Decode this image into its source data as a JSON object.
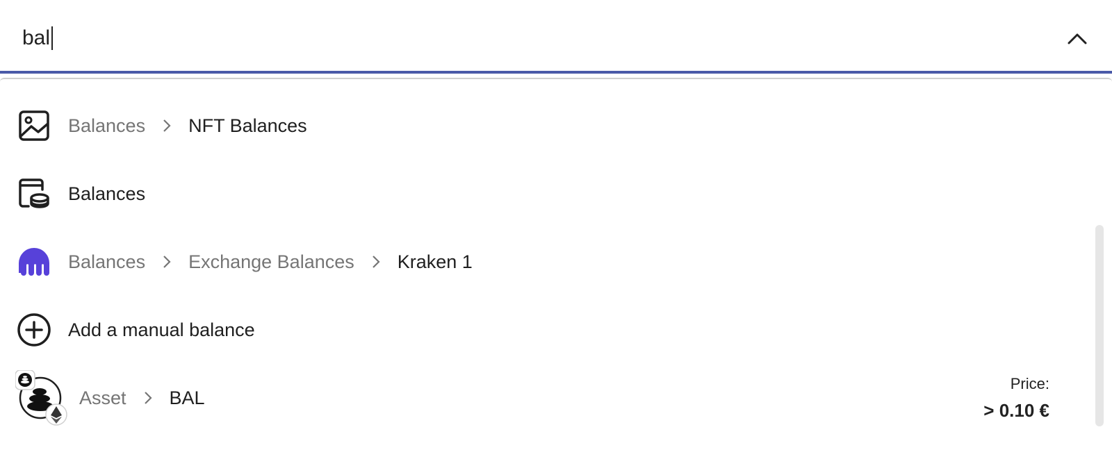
{
  "search": {
    "value": "bal",
    "collapse_icon": "chevron-up-icon"
  },
  "results": [
    {
      "icon": "image-icon",
      "crumbs": [
        "Balances"
      ],
      "title": "NFT Balances"
    },
    {
      "icon": "wallet-coins-icon",
      "crumbs": [],
      "title": "Balances"
    },
    {
      "icon": "kraken-icon",
      "icon_color": "#5741d9",
      "crumbs": [
        "Balances",
        "Exchange Balances"
      ],
      "title": "Kraken 1"
    },
    {
      "icon": "add-circle-icon",
      "crumbs": [],
      "title": "Add a manual balance"
    },
    {
      "icon": "bal-token-icon",
      "badge_icon": "ethereum-icon",
      "crumbs": [
        "Asset"
      ],
      "title": "BAL",
      "price_label": "Price:",
      "price_value": "> 0.10 €"
    }
  ],
  "colors": {
    "accent": "#4a5aa8",
    "muted_text": "#757575",
    "text": "#1f1f1f"
  }
}
